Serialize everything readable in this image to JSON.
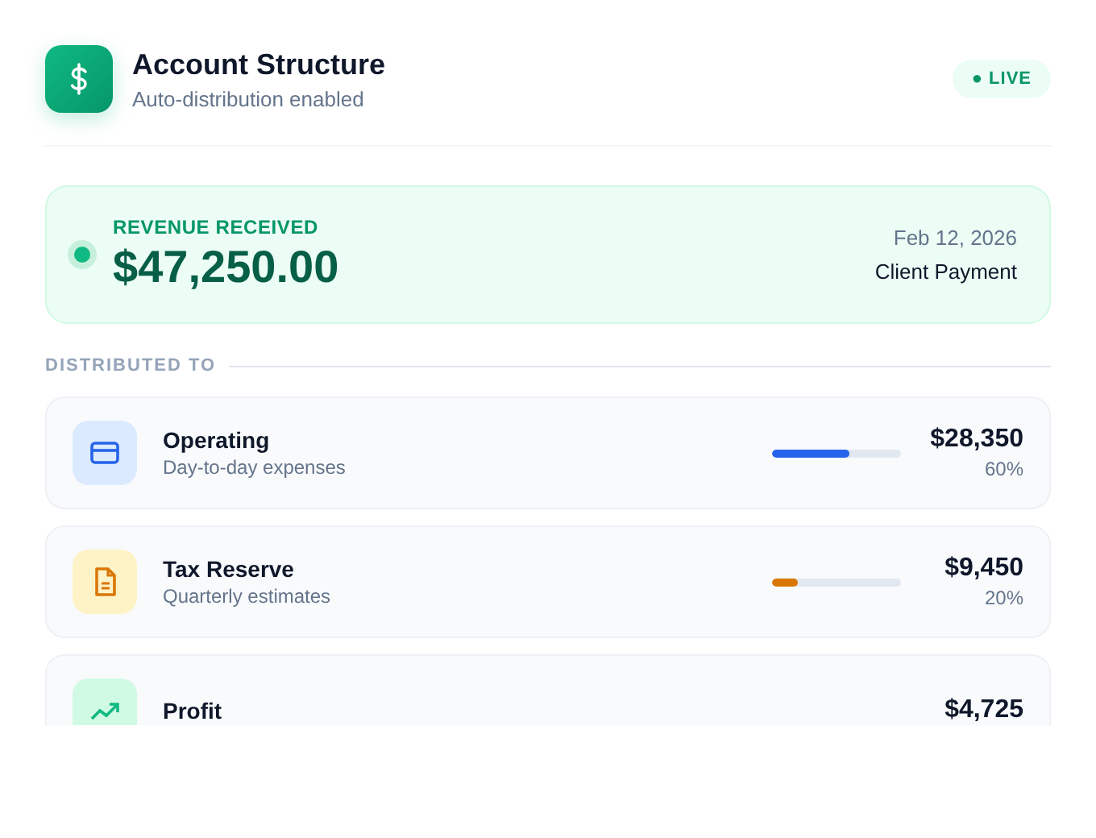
{
  "header": {
    "title": "Account Structure",
    "subtitle": "Auto-distribution enabled",
    "badge": "● LIVE"
  },
  "revenue": {
    "label": "REVENUE RECEIVED",
    "amount": "$47,250.00",
    "date": "Feb 12, 2026",
    "source": "Client Payment"
  },
  "section_label": "DISTRIBUTED TO",
  "accounts": [
    {
      "kind": "card",
      "name": "Operating",
      "description": "Day-to-day expenses",
      "amount": "$28,350",
      "percent": "60%",
      "level": 0.6,
      "color": "#2563eb"
    },
    {
      "kind": "document",
      "name": "Tax Reserve",
      "description": "Quarterly estimates",
      "amount": "$9,450",
      "percent": "20%",
      "level": 0.2,
      "color": "#d97706"
    },
    {
      "kind": "profit",
      "name": "Profit",
      "amount": "$4,725",
      "color": "#10b981"
    }
  ]
}
